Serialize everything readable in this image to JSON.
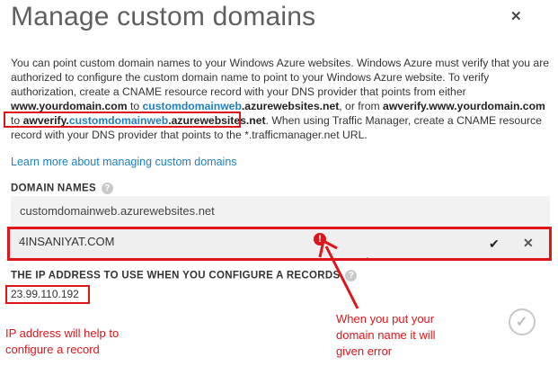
{
  "dialog": {
    "title": "Manage custom domains",
    "close_symbol": "✕"
  },
  "description": {
    "p1": "You can point custom domain names to your Windows Azure websites. Windows Azure must verify that you are authorized to configure the custom domain name to point to your Windows Azure website. To verify authorization, create a CNAME resource record with your DNS provider that points from either ",
    "b1": "www.yourdomain.com",
    "t2": " to ",
    "b2a": "customdomainweb",
    "b2b": ".azurewebsites.net",
    "t3": ", or from ",
    "b3": "awverify.www.yourdomain.com",
    "t4": " to ",
    "b4a": "awverify.",
    "b4b": "customdomainweb",
    "b4c": ".azurewebsites.net",
    "t5": ". When using Traffic Manager, create a CNAME resource record with your DNS provider that points to the *.trafficmanager.net URL."
  },
  "learn_more": "Learn more about managing custom domains",
  "domain_names": {
    "label": "DOMAIN NAMES",
    "existing": "customdomainweb.azurewebsites.net",
    "new_value": "4INSANIYAT.COM",
    "error_symbol": "!"
  },
  "ip_section": {
    "label": "THE IP ADDRESS TO USE WHEN YOU CONFIGURE A RECORDS",
    "value": "23.99.110.192"
  },
  "annotations": {
    "ip_note_1": "IP address will help to",
    "ip_note_2": "configure a record",
    "error_note_1": "When you put your",
    "error_note_2": "domain name it will",
    "error_note_3": "given error"
  },
  "icons": {
    "help": "?",
    "check": "✔",
    "remove": "✕",
    "ok": "✓"
  },
  "colors": {
    "accent_blue": "#1e7fc0",
    "annotation_red": "#e0151b"
  }
}
